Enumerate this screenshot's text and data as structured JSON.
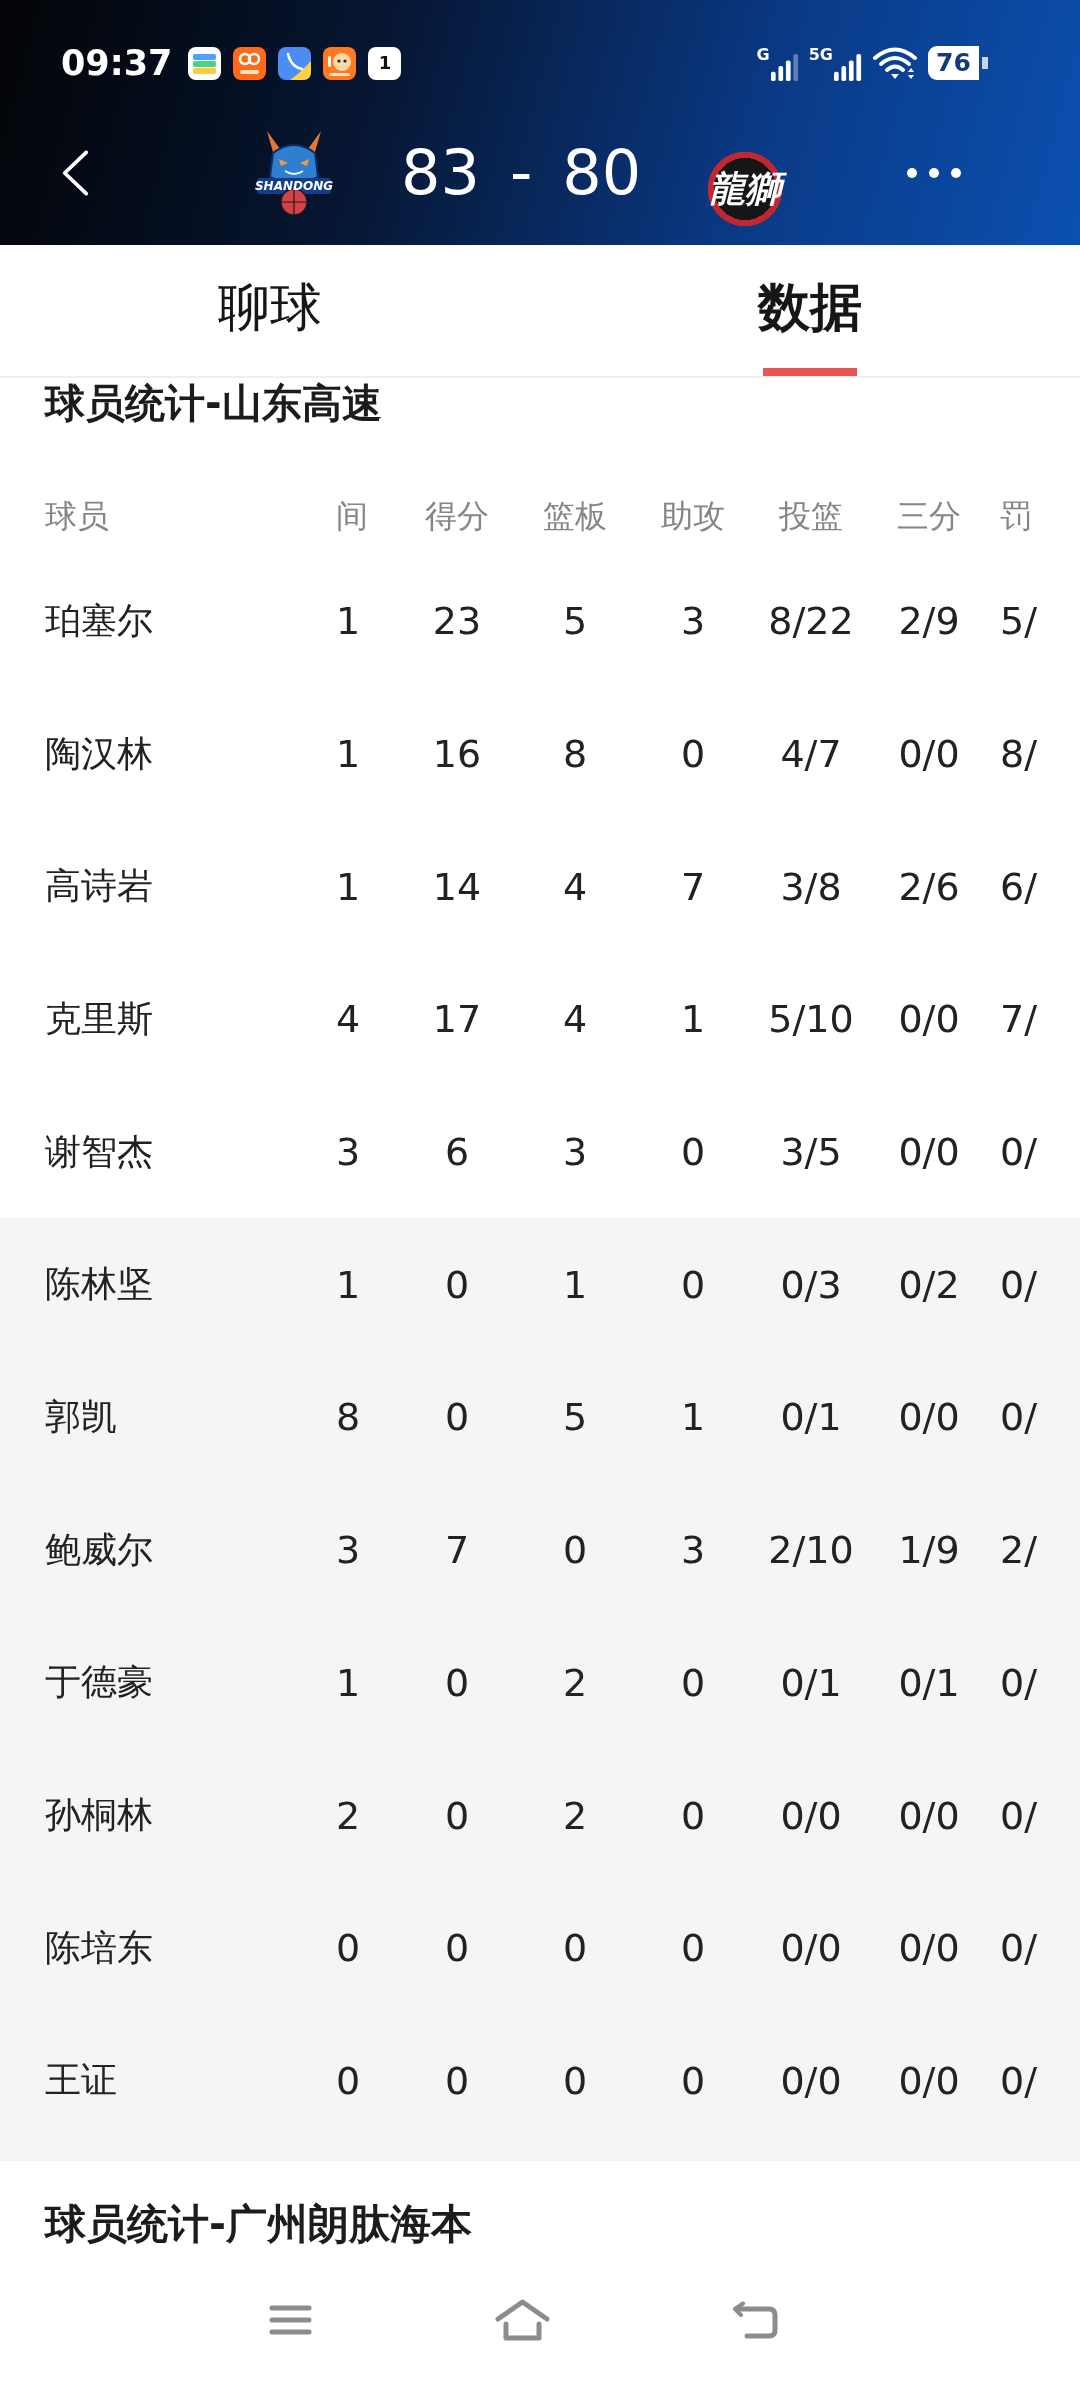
{
  "status_bar": {
    "time": "09:37",
    "calendar_day": "1",
    "sim1_network": "G",
    "sim2_network": "5G",
    "battery": "76"
  },
  "header": {
    "home_team": {
      "logo_text": "SHANDONG",
      "score": "83"
    },
    "score_separator": "-",
    "away_team": {
      "score": "80",
      "logo_text": "龍獅"
    }
  },
  "tabs": [
    {
      "label": "聊球",
      "selected": false
    },
    {
      "label": "数据",
      "selected": true
    }
  ],
  "sections": [
    {
      "title": "球员统计-山东高速",
      "table": {
        "columns": [
          "球员",
          "间",
          "得分",
          "篮板",
          "助攻",
          "投篮",
          "三分",
          "罚"
        ],
        "starters": [
          {
            "name": "珀塞尔",
            "stats": [
              "1",
              "23",
              "5",
              "3",
              "8/22",
              "2/9",
              "5/"
            ]
          },
          {
            "name": "陶汉林",
            "stats": [
              "1",
              "16",
              "8",
              "0",
              "4/7",
              "0/0",
              "8/"
            ]
          },
          {
            "name": "高诗岩",
            "stats": [
              "1",
              "14",
              "4",
              "7",
              "3/8",
              "2/6",
              "6/"
            ]
          },
          {
            "name": "克里斯",
            "stats": [
              "4",
              "17",
              "4",
              "1",
              "5/10",
              "0/0",
              "7/"
            ]
          },
          {
            "name": "谢智杰",
            "stats": [
              "3",
              "6",
              "3",
              "0",
              "3/5",
              "0/0",
              "0/"
            ]
          }
        ],
        "bench": [
          {
            "name": "陈林坚",
            "stats": [
              "1",
              "0",
              "1",
              "0",
              "0/3",
              "0/2",
              "0/"
            ]
          },
          {
            "name": "郭凯",
            "stats": [
              "8",
              "0",
              "5",
              "1",
              "0/1",
              "0/0",
              "0/"
            ]
          },
          {
            "name": "鲍威尔",
            "stats": [
              "3",
              "7",
              "0",
              "3",
              "2/10",
              "1/9",
              "2/"
            ]
          },
          {
            "name": "于德豪",
            "stats": [
              "1",
              "0",
              "2",
              "0",
              "0/1",
              "0/1",
              "0/"
            ]
          },
          {
            "name": "孙桐林",
            "stats": [
              "2",
              "0",
              "2",
              "0",
              "0/0",
              "0/0",
              "0/"
            ]
          },
          {
            "name": "陈培东",
            "stats": [
              "0",
              "0",
              "0",
              "0",
              "0/0",
              "0/0",
              "0/"
            ]
          },
          {
            "name": "王证",
            "stats": [
              "0",
              "0",
              "0",
              "0",
              "0/0",
              "0/0",
              "0/"
            ]
          }
        ]
      }
    },
    {
      "title": "球员统计-广州朗肽海本"
    }
  ]
}
